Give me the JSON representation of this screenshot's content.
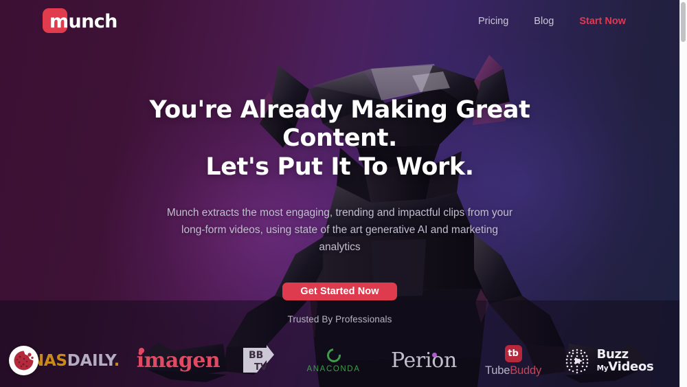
{
  "brand": {
    "logo_text": "munch",
    "logo_tile_color": "#e03c4e",
    "accent_color": "#e0384f",
    "cta_color": "#df3b4e"
  },
  "header": {
    "nav": [
      {
        "label": "Pricing",
        "accent": false
      },
      {
        "label": "Blog",
        "accent": false
      },
      {
        "label": "Start Now",
        "accent": true
      }
    ]
  },
  "hero": {
    "title_line1": "You're Already Making Great Content.",
    "title_line2": "Let's Put It To Work.",
    "subtitle": "Munch extracts the most engaging, trending and impactful clips from your long-form videos, using state of the art generative AI and marketing analytics",
    "cta_label": "Get Started Now"
  },
  "trusted": {
    "label": "Trusted By Professionals",
    "logos": [
      {
        "name": "nasdaily",
        "part1": "NAS",
        "part2": "DAILY",
        "part3": "."
      },
      {
        "name": "imagen",
        "text": "imagen"
      },
      {
        "name": "bbtv",
        "top": "BB",
        "bottom": "TV"
      },
      {
        "name": "anaconda",
        "text": "ANACONDA"
      },
      {
        "name": "perion",
        "text": "Perion"
      },
      {
        "name": "tubebuddy",
        "tile": "tb",
        "part1": "Tube",
        "part2": "Buddy"
      },
      {
        "name": "buzzmyvideos",
        "row1": "Buzz",
        "row2_small": "My",
        "row2": "Videos"
      }
    ]
  },
  "cookie": {
    "icon": "cookie-icon"
  },
  "scrollbar": {
    "position": "top"
  }
}
